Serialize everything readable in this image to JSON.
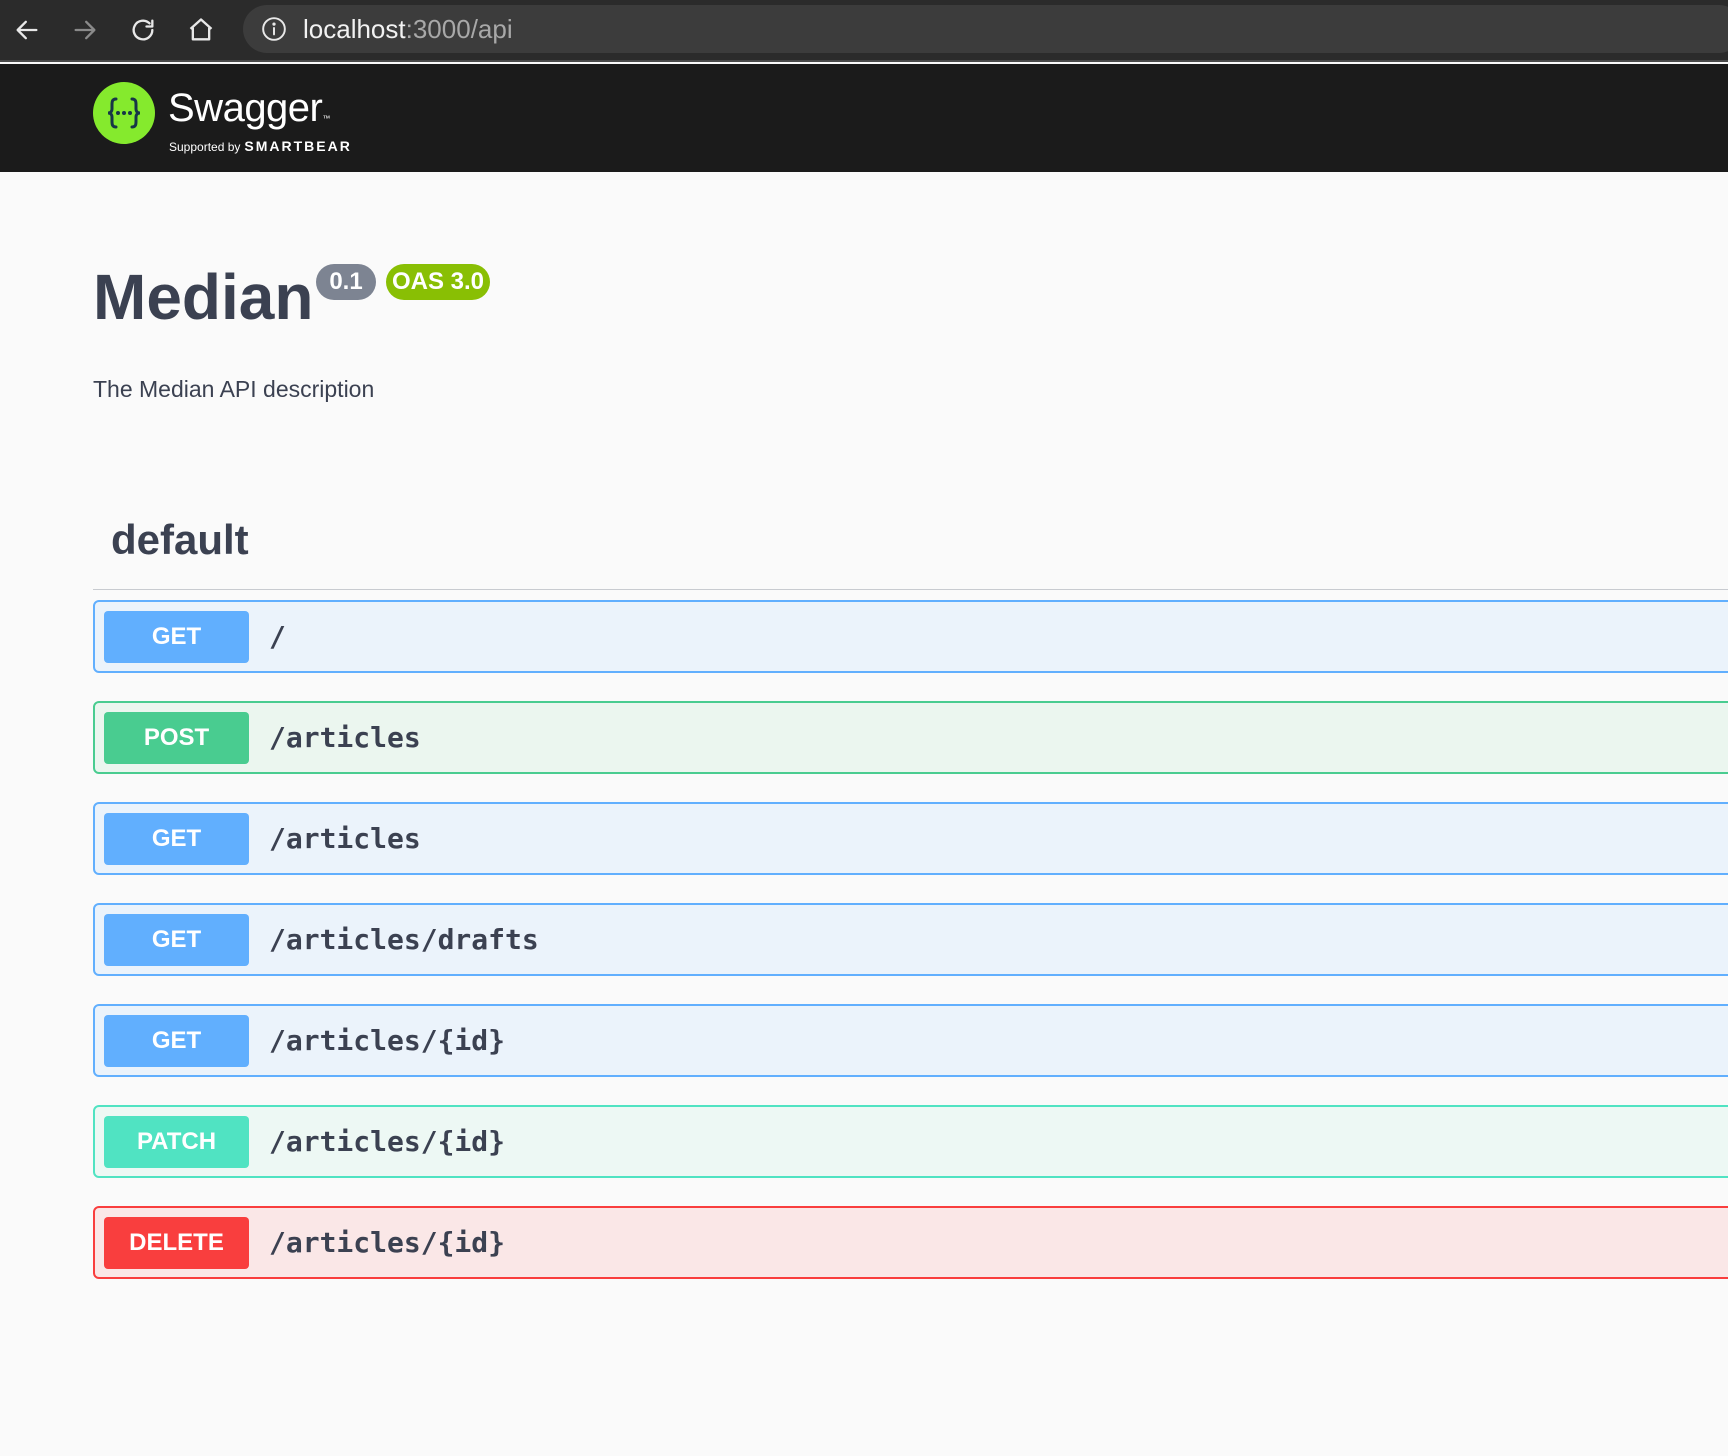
{
  "browser": {
    "url_host": "localhost",
    "url_path": ":3000/api",
    "icons": [
      "back-arrow-icon",
      "forward-arrow-icon",
      "reload-icon",
      "home-icon",
      "info-icon"
    ]
  },
  "topbar": {
    "logo_name": "Swagger",
    "logo_tm": "™",
    "supported_by": "Supported by",
    "brand": "SMARTBEAR"
  },
  "info": {
    "title": "Median",
    "version": "0.1",
    "oas": "OAS 3.0",
    "description": "The Median API description"
  },
  "tag": {
    "name": "default"
  },
  "operations": [
    {
      "method": "GET",
      "path": "/"
    },
    {
      "method": "POST",
      "path": "/articles"
    },
    {
      "method": "GET",
      "path": "/articles"
    },
    {
      "method": "GET",
      "path": "/articles/drafts"
    },
    {
      "method": "GET",
      "path": "/articles/{id}"
    },
    {
      "method": "PATCH",
      "path": "/articles/{id}"
    },
    {
      "method": "DELETE",
      "path": "/articles/{id}"
    }
  ],
  "colors": {
    "get": "#61affe",
    "post": "#49cc90",
    "patch": "#50e3c2",
    "delete": "#f93e3e",
    "swagger_green": "#85ea2d",
    "oas_badge": "#89bf04"
  }
}
